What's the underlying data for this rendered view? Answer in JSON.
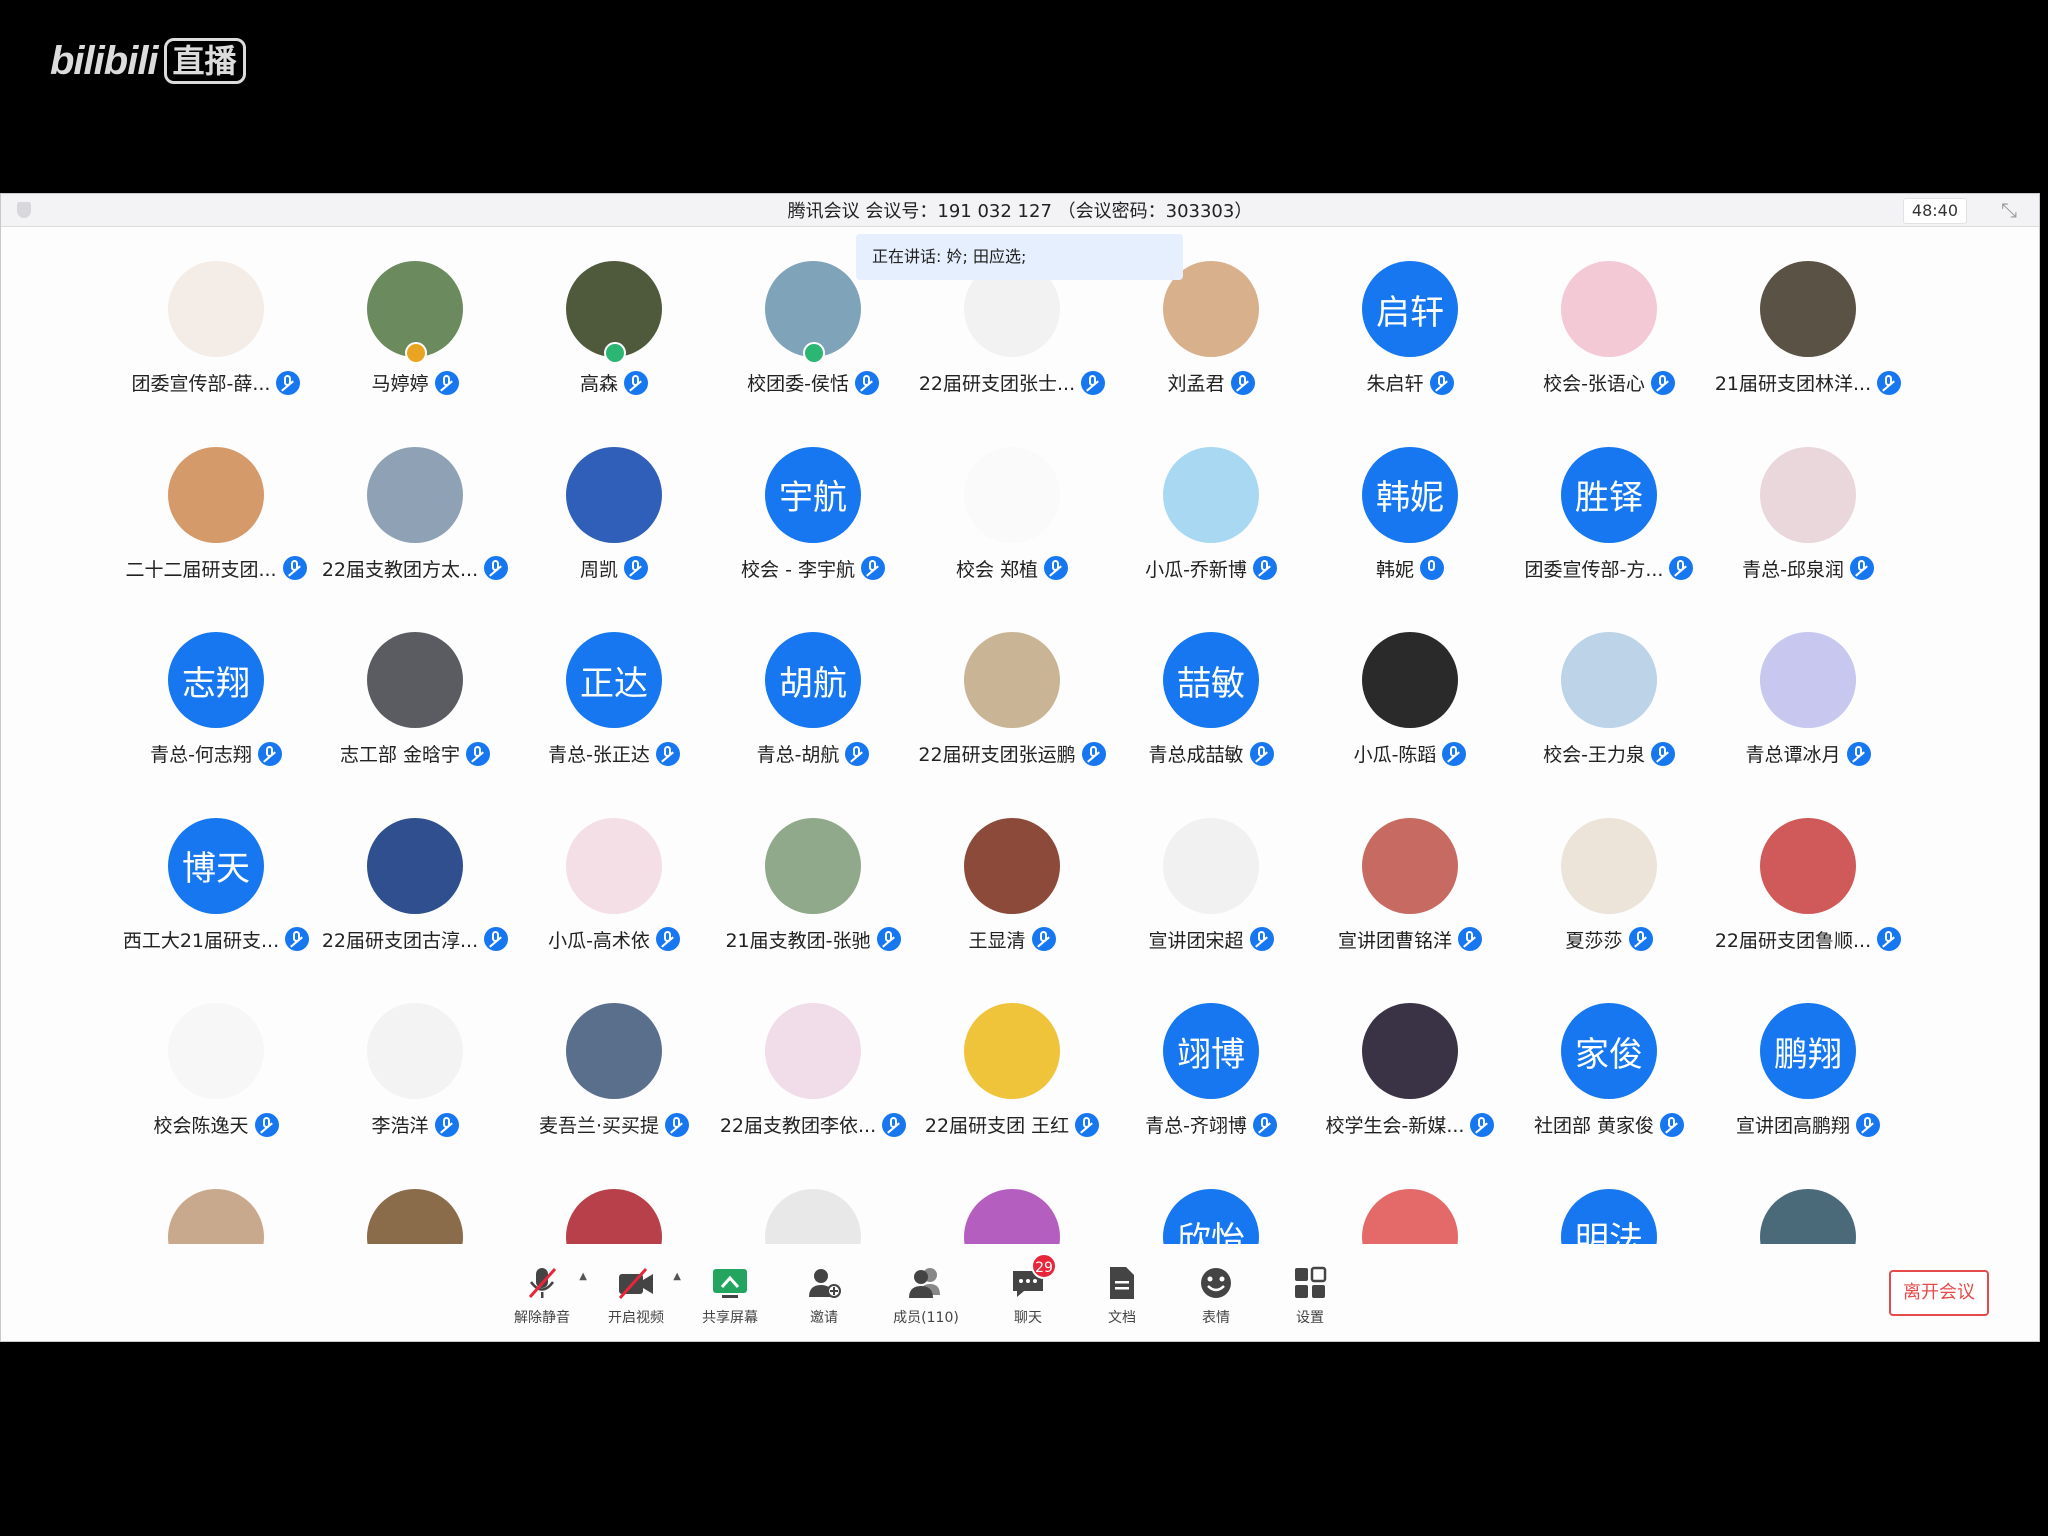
{
  "watermark": {
    "brand": "bilibili",
    "live": "直播"
  },
  "window": {
    "title": "腾讯会议 会议号：191 032 127 （会议密码：303303）",
    "timer": "48:40",
    "speaking": "正在讲话: 妗; 田应选;"
  },
  "participants": [
    {
      "name": "团委宣传部-薛...",
      "avatar_text": "",
      "color": "#f4ece6",
      "mic": "muted"
    },
    {
      "name": "马婷婷",
      "avatar_text": "",
      "color": "#6b8a5e",
      "mic": "muted",
      "badge": "gold"
    },
    {
      "name": "高森",
      "avatar_text": "",
      "color": "#4f5a3c",
      "mic": "muted",
      "badge": "green"
    },
    {
      "name": "校团委-侯恬",
      "avatar_text": "",
      "color": "#7fa3b8",
      "mic": "muted",
      "badge": "green"
    },
    {
      "name": "22届研支团张士...",
      "avatar_text": "",
      "color": "#f2f2f2",
      "mic": "muted"
    },
    {
      "name": "刘孟君",
      "avatar_text": "",
      "color": "#d8b18c",
      "mic": "muted"
    },
    {
      "name": "朱启轩",
      "avatar_text": "启轩",
      "color": "#1677f0",
      "mic": "muted"
    },
    {
      "name": "校会-张语心",
      "avatar_text": "",
      "color": "#f3c9d6",
      "mic": "muted"
    },
    {
      "name": "21届研支团林洋...",
      "avatar_text": "",
      "color": "#5b5246",
      "mic": "muted"
    },
    {
      "name": "二十二届研支团...",
      "avatar_text": "",
      "color": "#d49a6a",
      "mic": "muted"
    },
    {
      "name": "22届支教团方太...",
      "avatar_text": "",
      "color": "#8fa2b5",
      "mic": "muted"
    },
    {
      "name": "周凯",
      "avatar_text": "",
      "color": "#2f5fb8",
      "mic": "muted"
    },
    {
      "name": "校会 - 李宇航",
      "avatar_text": "宇航",
      "color": "#1677f0",
      "mic": "muted"
    },
    {
      "name": "校会 郑植",
      "avatar_text": "",
      "color": "#fafafa",
      "mic": "muted"
    },
    {
      "name": "小瓜-乔新博",
      "avatar_text": "",
      "color": "#a9d9f2",
      "mic": "muted"
    },
    {
      "name": "韩妮",
      "avatar_text": "韩妮",
      "color": "#1677f0",
      "mic": "on"
    },
    {
      "name": "团委宣传部-方...",
      "avatar_text": "胜铎",
      "color": "#1677f0",
      "mic": "muted"
    },
    {
      "name": "青总-邱泉润",
      "avatar_text": "",
      "color": "#e9d7dc",
      "mic": "muted"
    },
    {
      "name": "青总-何志翔",
      "avatar_text": "志翔",
      "color": "#1677f0",
      "mic": "muted"
    },
    {
      "name": "志工部 金晗宇",
      "avatar_text": "",
      "color": "#5a5c62",
      "mic": "muted"
    },
    {
      "name": "青总-张正达",
      "avatar_text": "正达",
      "color": "#1677f0",
      "mic": "muted"
    },
    {
      "name": "青总-胡航",
      "avatar_text": "胡航",
      "color": "#1677f0",
      "mic": "muted"
    },
    {
      "name": "22届研支团张运鹏",
      "avatar_text": "",
      "color": "#c9b595",
      "mic": "muted"
    },
    {
      "name": "青总成喆敏",
      "avatar_text": "喆敏",
      "color": "#1677f0",
      "mic": "muted"
    },
    {
      "name": "小瓜-陈蹈",
      "avatar_text": "",
      "color": "#2a2a2a",
      "mic": "muted"
    },
    {
      "name": "校会-王力泉",
      "avatar_text": "",
      "color": "#bcd3e8",
      "mic": "muted"
    },
    {
      "name": "青总谭冰月",
      "avatar_text": "",
      "color": "#c7c7ef",
      "mic": "muted"
    },
    {
      "name": "西工大21届研支...",
      "avatar_text": "博天",
      "color": "#1677f0",
      "mic": "muted"
    },
    {
      "name": "22届研支团古淳...",
      "avatar_text": "",
      "color": "#2f4f8f",
      "mic": "muted"
    },
    {
      "name": "小瓜-高术依",
      "avatar_text": "",
      "color": "#f4dfe6",
      "mic": "muted"
    },
    {
      "name": "21届支教团-张驰",
      "avatar_text": "",
      "color": "#90a98a",
      "mic": "muted"
    },
    {
      "name": "王显清",
      "avatar_text": "",
      "color": "#8b4a3a",
      "mic": "muted"
    },
    {
      "name": "宣讲团宋超",
      "avatar_text": "",
      "color": "#f1f1f1",
      "mic": "muted"
    },
    {
      "name": "宣讲团曹铭洋",
      "avatar_text": "",
      "color": "#c76b62",
      "mic": "muted"
    },
    {
      "name": "夏莎莎",
      "avatar_text": "",
      "color": "#ece4d8",
      "mic": "muted"
    },
    {
      "name": "22届研支团鲁顺...",
      "avatar_text": "",
      "color": "#d05a5a",
      "mic": "muted"
    },
    {
      "name": "校会陈逸天",
      "avatar_text": "",
      "color": "#f7f7f7",
      "mic": "muted"
    },
    {
      "name": "李浩洋",
      "avatar_text": "",
      "color": "#f3f3f3",
      "mic": "muted"
    },
    {
      "name": "麦吾兰·买买提",
      "avatar_text": "",
      "color": "#5a6f8c",
      "mic": "muted"
    },
    {
      "name": "22届支教团李依...",
      "avatar_text": "",
      "color": "#f1dcea",
      "mic": "muted"
    },
    {
      "name": "22届研支团 王红",
      "avatar_text": "",
      "color": "#f0c43a",
      "mic": "muted"
    },
    {
      "name": "青总-齐翊博",
      "avatar_text": "翊博",
      "color": "#1677f0",
      "mic": "muted"
    },
    {
      "name": "校学生会-新媒...",
      "avatar_text": "",
      "color": "#3a3346",
      "mic": "muted"
    },
    {
      "name": "社团部 黄家俊",
      "avatar_text": "家俊",
      "color": "#1677f0",
      "mic": "muted"
    },
    {
      "name": "宣讲团高鹏翔",
      "avatar_text": "鹏翔",
      "color": "#1677f0",
      "mic": "muted"
    },
    {
      "name": "",
      "avatar_text": "",
      "color": "#c9a98d",
      "mic": "none"
    },
    {
      "name": "",
      "avatar_text": "",
      "color": "#8a6b4a",
      "mic": "none"
    },
    {
      "name": "",
      "avatar_text": "",
      "color": "#b8404a",
      "mic": "none"
    },
    {
      "name": "",
      "avatar_text": "",
      "color": "#e8e8e8",
      "mic": "none"
    },
    {
      "name": "",
      "avatar_text": "",
      "color": "#b45fbf",
      "mic": "none"
    },
    {
      "name": "",
      "avatar_text": "欣怡",
      "color": "#1677f0",
      "mic": "none"
    },
    {
      "name": "",
      "avatar_text": "",
      "color": "#e46a6a",
      "mic": "none"
    },
    {
      "name": "",
      "avatar_text": "明法",
      "color": "#1677f0",
      "mic": "none"
    },
    {
      "name": "",
      "avatar_text": "",
      "color": "#4a6a7a",
      "mic": "none"
    }
  ],
  "toolbar": {
    "unmute": "解除静音",
    "video": "开启视频",
    "share": "共享屏幕",
    "invite": "邀请",
    "members": "成员(110)",
    "chat": "聊天",
    "chat_badge": "29",
    "docs": "文档",
    "emoji": "表情",
    "settings": "设置",
    "leave": "离开会议"
  }
}
